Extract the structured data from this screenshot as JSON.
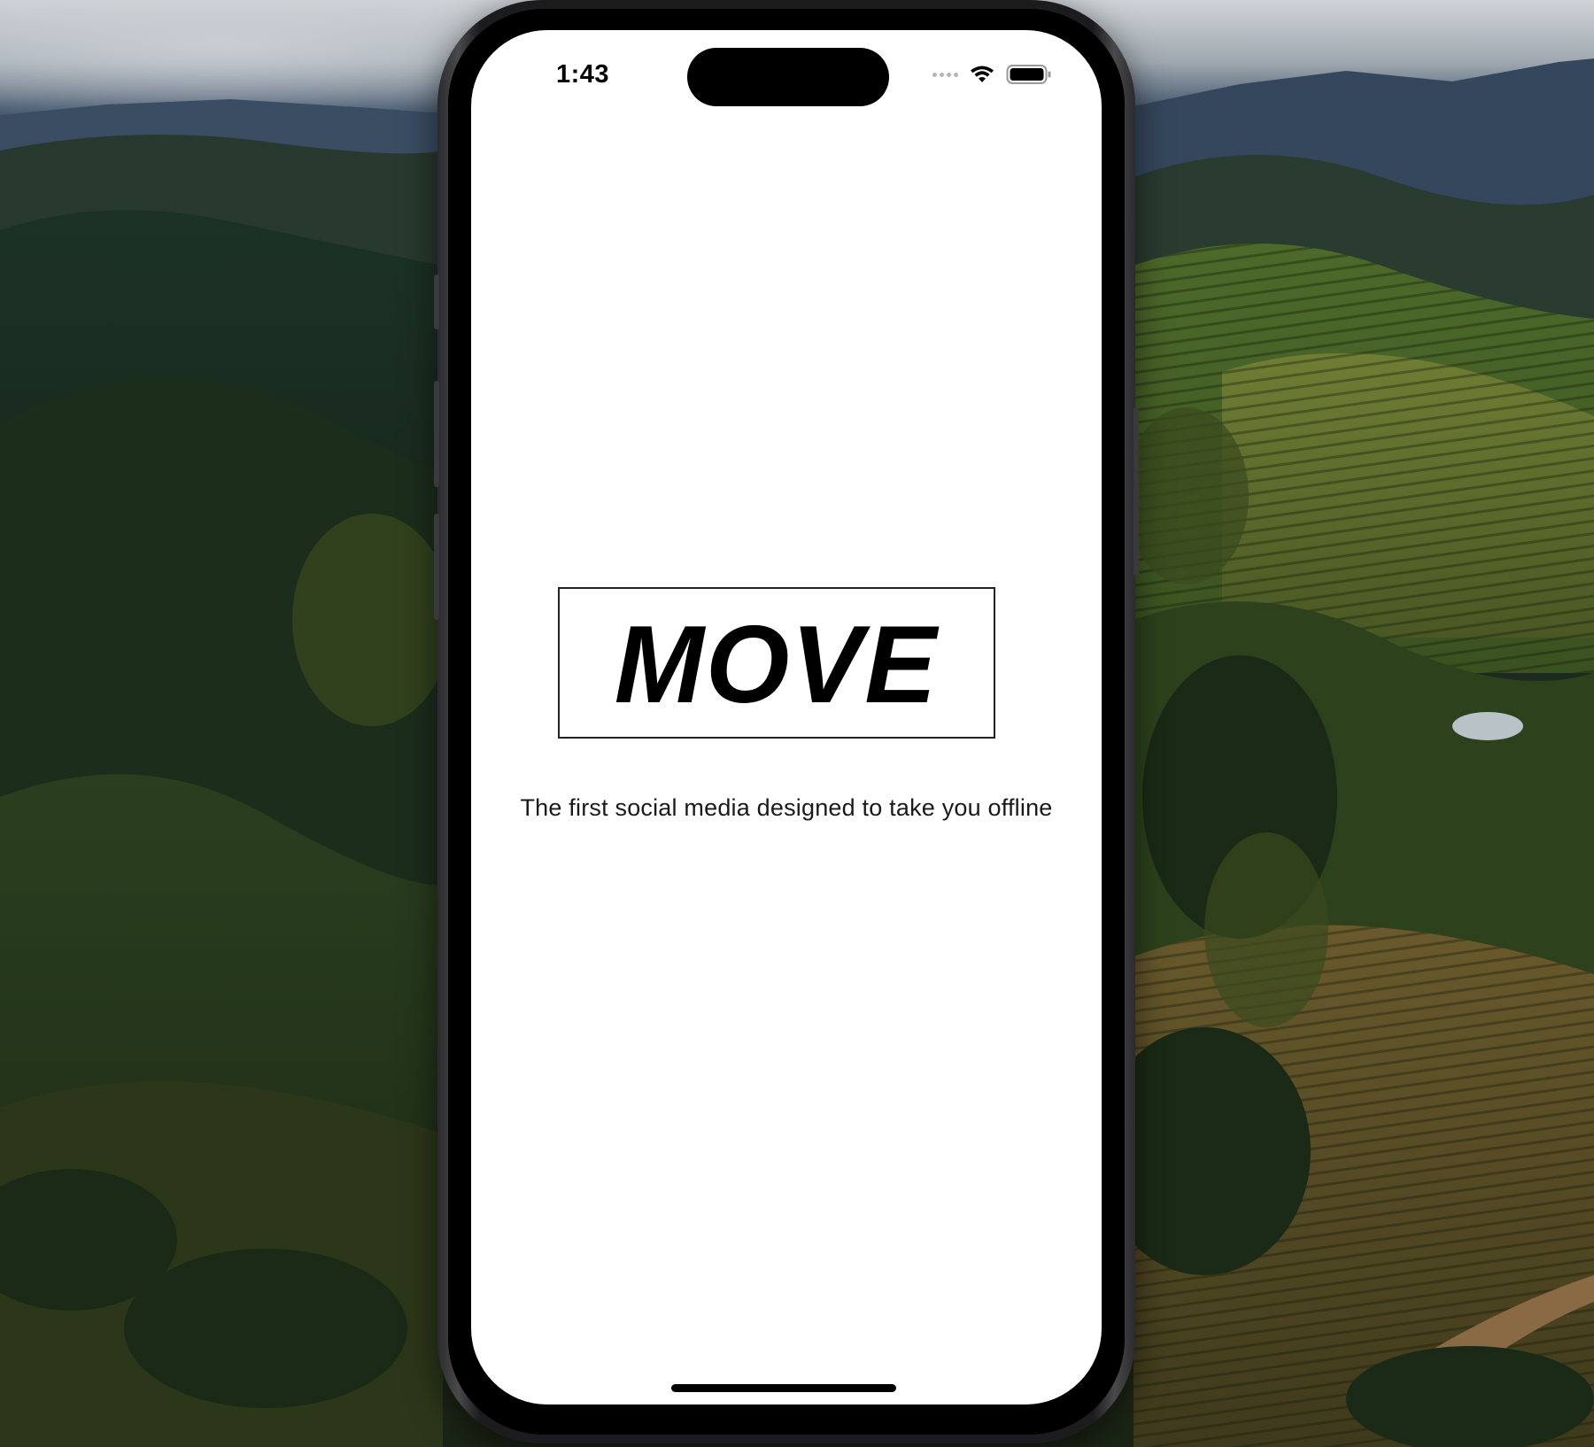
{
  "status_bar": {
    "time": "1:43",
    "icons": [
      "signal-dots-icon",
      "wifi-icon",
      "battery-icon"
    ]
  },
  "splash": {
    "logo": "MOVE",
    "tagline": "The first social media designed to take you offline"
  },
  "colors": {
    "screen_background": "#ffffff",
    "text": "#000000",
    "phone_frame": "#1c1c1e"
  }
}
